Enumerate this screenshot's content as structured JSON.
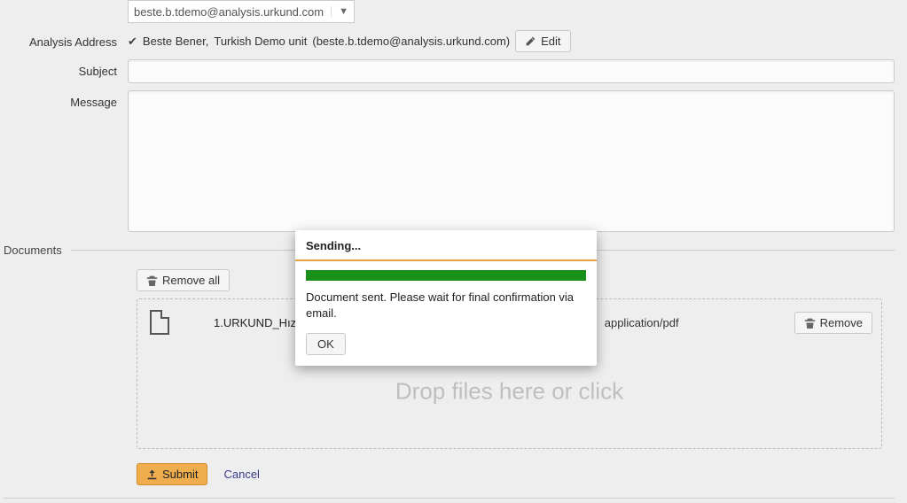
{
  "emailSelect": {
    "value": "beste.b.tdemo@analysis.urkund.com"
  },
  "labels": {
    "analysisAddress": "Analysis Address",
    "subject": "Subject",
    "message": "Message",
    "documents": "Documents"
  },
  "verified": {
    "name": "Beste Bener,",
    "unit": "Turkish Demo unit",
    "email": "(beste.b.tdemo@analysis.urkund.com)"
  },
  "buttons": {
    "edit": "Edit",
    "removeAll": "Remove all",
    "remove": "Remove",
    "submit": "Submit",
    "cancel": "Cancel",
    "ok": "OK"
  },
  "dropzone": {
    "placeholder": "Drop files here or click"
  },
  "file": {
    "name": "1.URKUND_Hızlı Bşlanı",
    "type": "application/pdf"
  },
  "modal": {
    "title": "Sending...",
    "message": "Document sent. Please wait for final confirmation via email."
  }
}
